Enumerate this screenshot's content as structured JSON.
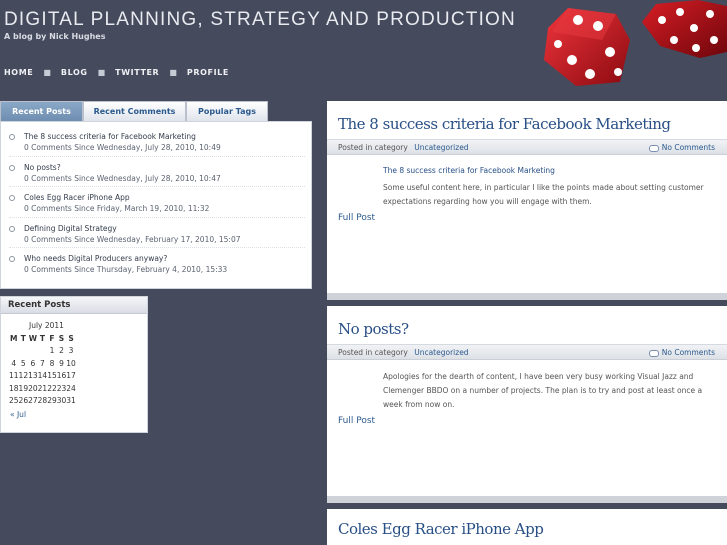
{
  "site": {
    "title": "DIGITAL PLANNING, STRATEGY AND PRODUCTION",
    "tagline": "A blog by Nick Hughes"
  },
  "nav": [
    "HOME",
    "BLOG",
    "TWITTER",
    "PROFILE"
  ],
  "tabs": [
    "Recent Posts",
    "Recent Comments",
    "Popular Tags"
  ],
  "recent_posts": [
    {
      "title": "The 8 success criteria for Facebook Marketing",
      "meta": "0 Comments Since Wednesday, July 28, 2010, 10:49"
    },
    {
      "title": "No posts?",
      "meta": "0 Comments Since Wednesday, July 28, 2010, 10:47"
    },
    {
      "title": "Coles Egg Racer iPhone App",
      "meta": "0 Comments Since Friday, March 19, 2010, 11:32"
    },
    {
      "title": "Defining Digital Strategy",
      "meta": "0 Comments Since Wednesday, February 17, 2010, 15:07"
    },
    {
      "title": "Who needs Digital Producers anyway?",
      "meta": "0 Comments Since Thursday, February 4, 2010, 15:33"
    }
  ],
  "calendar": {
    "heading": "Recent Posts",
    "caption": "July 2011",
    "days": [
      "M",
      "T",
      "W",
      "T",
      "F",
      "S",
      "S"
    ],
    "weeks": [
      [
        "",
        "",
        "",
        "",
        "1",
        "2",
        "3"
      ],
      [
        "4",
        "5",
        "6",
        "7",
        "8",
        "9",
        "10"
      ],
      [
        "11",
        "12",
        "13",
        "14",
        "15",
        "16",
        "17"
      ],
      [
        "18",
        "19",
        "20",
        "21",
        "22",
        "23",
        "24"
      ],
      [
        "25",
        "26",
        "27",
        "28",
        "29",
        "30",
        "31"
      ]
    ],
    "prev": "« Jul"
  },
  "posts": [
    {
      "title": "The 8 success criteria for Facebook Marketing",
      "posted_in": "Posted in category",
      "category": "Uncategorized",
      "comments": "No Comments",
      "link": "The 8 success criteria for Facebook Marketing",
      "body": "Some useful content here, in particular I like the points made about setting customer expectations regarding how you will engage with them.",
      "full": "Full Post"
    },
    {
      "title": "No posts?",
      "posted_in": "Posted in category",
      "category": "Uncategorized",
      "comments": "No Comments",
      "body": "Apologies for the dearth of content, I have been very busy working Visual Jazz and Clemenger BBDO on a number of projects. The plan is to try and post at least once a week from now on.",
      "full": "Full Post"
    },
    {
      "title": "Coles Egg Racer iPhone App"
    }
  ],
  "colors": {
    "background": "#454a5c",
    "link": "#2b5a8e",
    "dice": "#c4101a"
  },
  "icons": [
    "dice-icon",
    "comment-icon"
  ]
}
